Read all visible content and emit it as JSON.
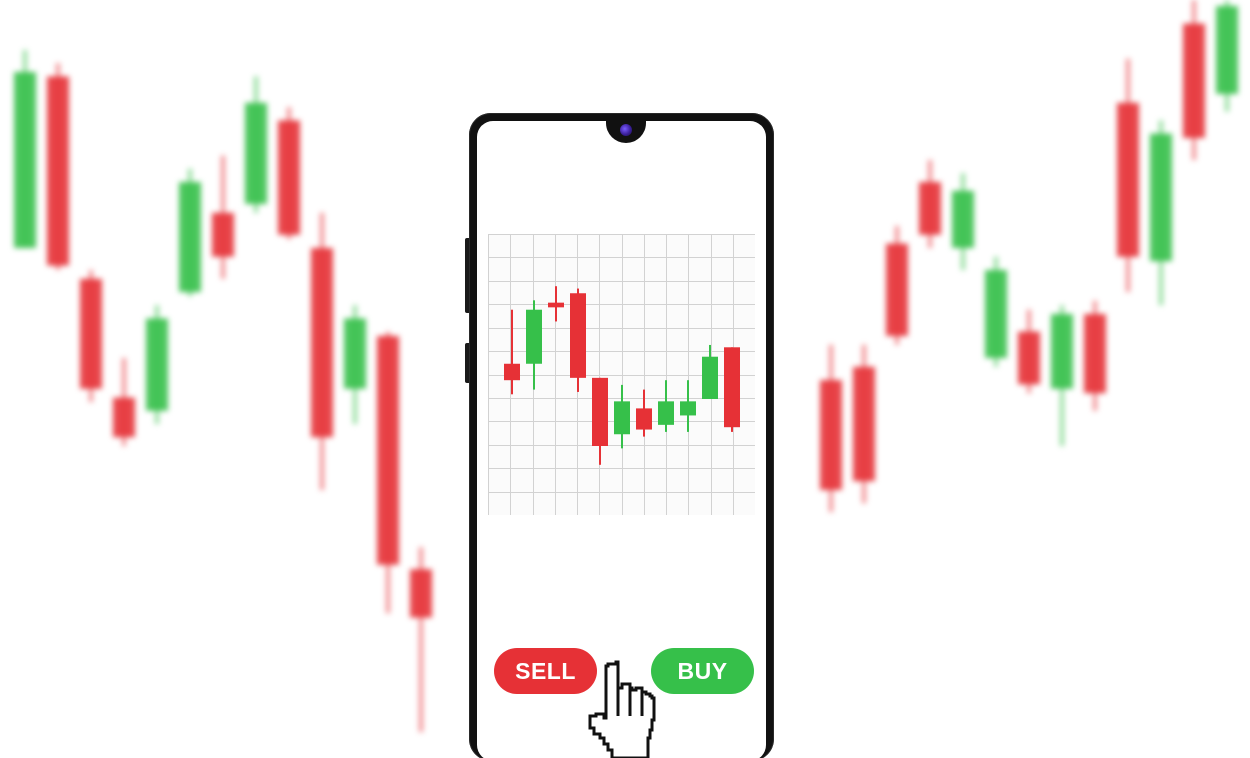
{
  "screen": {
    "sell_label": "SELL",
    "buy_label": "BUY"
  },
  "colors": {
    "bullish": "#36c04a",
    "bearish": "#e63136",
    "grid": "#d2d2d2",
    "phone_body": "#111111"
  },
  "chart_data": {
    "type": "candlestick",
    "title": "",
    "xlabel": "",
    "ylabel": "",
    "grid": true,
    "ylim": [
      0,
      100
    ],
    "candles": [
      {
        "open": 55,
        "high": 78,
        "low": 42,
        "close": 48
      },
      {
        "open": 55,
        "high": 82,
        "low": 44,
        "close": 78
      },
      {
        "open": 81,
        "high": 88,
        "low": 73,
        "close": 79
      },
      {
        "open": 85,
        "high": 87,
        "low": 43,
        "close": 49
      },
      {
        "open": 49,
        "high": 49,
        "low": 12,
        "close": 20
      },
      {
        "open": 25,
        "high": 46,
        "low": 19,
        "close": 39
      },
      {
        "open": 36,
        "high": 44,
        "low": 24,
        "close": 27
      },
      {
        "open": 29,
        "high": 48,
        "low": 26,
        "close": 39
      },
      {
        "open": 33,
        "high": 48,
        "low": 26,
        "close": 39
      },
      {
        "open": 40,
        "high": 63,
        "low": 40,
        "close": 58
      },
      {
        "open": 62,
        "high": 62,
        "low": 26,
        "close": 28
      }
    ]
  },
  "background": {
    "left_candles": [
      {
        "open": 55,
        "high": 100,
        "low": 55,
        "close": 95
      },
      {
        "open": 94,
        "high": 97,
        "low": 50,
        "close": 51
      },
      {
        "open": 48,
        "high": 50,
        "low": 20,
        "close": 23
      },
      {
        "open": 21,
        "high": 30,
        "low": 10,
        "close": 12
      },
      {
        "open": 18,
        "high": 42,
        "low": 15,
        "close": 39
      },
      {
        "open": 45,
        "high": 73,
        "low": 44,
        "close": 70
      },
      {
        "open": 63,
        "high": 76,
        "low": 48,
        "close": 53
      },
      {
        "open": 65,
        "high": 94,
        "low": 63,
        "close": 88
      },
      {
        "open": 84,
        "high": 87,
        "low": 57,
        "close": 58
      },
      {
        "open": 55,
        "high": 63,
        "low": 0,
        "close": 12
      },
      {
        "open": 23,
        "high": 42,
        "low": 15,
        "close": 39
      },
      {
        "open": 35,
        "high": 36,
        "low": -28,
        "close": -17
      },
      {
        "open": -18,
        "high": -13,
        "low": -55,
        "close": -29
      }
    ],
    "right_candles": [
      {
        "open": 25,
        "high": 33,
        "low": -5,
        "close": 0
      },
      {
        "open": 28,
        "high": 33,
        "low": -3,
        "close": 2
      },
      {
        "open": 56,
        "high": 60,
        "low": 33,
        "close": 35
      },
      {
        "open": 70,
        "high": 75,
        "low": 55,
        "close": 58
      },
      {
        "open": 55,
        "high": 72,
        "low": 50,
        "close": 68
      },
      {
        "open": 30,
        "high": 53,
        "low": 28,
        "close": 50
      },
      {
        "open": 36,
        "high": 41,
        "low": 22,
        "close": 24
      },
      {
        "open": 23,
        "high": 42,
        "low": 10,
        "close": 40
      },
      {
        "open": 40,
        "high": 43,
        "low": 18,
        "close": 22
      },
      {
        "open": 88,
        "high": 98,
        "low": 45,
        "close": 53
      },
      {
        "open": 52,
        "high": 84,
        "low": 42,
        "close": 81
      },
      {
        "open": 106,
        "high": 116,
        "low": 75,
        "close": 80
      },
      {
        "open": 90,
        "high": 124,
        "low": 86,
        "close": 110
      }
    ]
  }
}
